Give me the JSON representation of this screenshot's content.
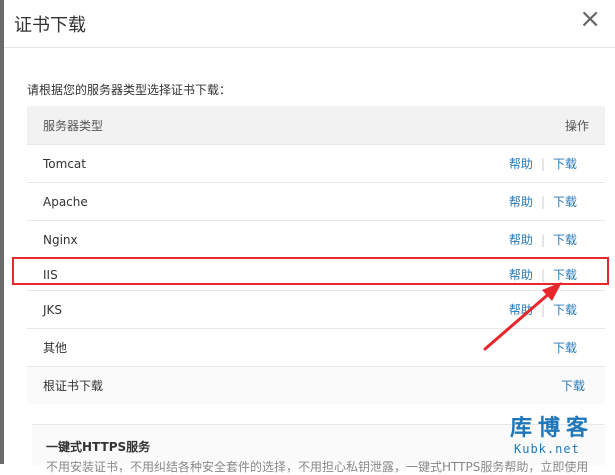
{
  "dialog": {
    "title": "证书下载",
    "close_icon": "×",
    "instruction": "请根据您的服务器类型选择证书下载："
  },
  "table": {
    "header_server": "服务器类型",
    "header_action": "操作",
    "rows": [
      {
        "name": "Tomcat",
        "help": "帮助",
        "download": "下载"
      },
      {
        "name": "Apache",
        "help": "帮助",
        "download": "下载"
      },
      {
        "name": "Nginx",
        "help": "帮助",
        "download": "下载"
      },
      {
        "name": "IIS",
        "help": "帮助",
        "download": "下载"
      },
      {
        "name": "JKS",
        "help": "帮助",
        "download": "下载"
      },
      {
        "name": "其他",
        "download": "下载"
      },
      {
        "name": "根证书下载",
        "download": "下载"
      }
    ]
  },
  "promo": {
    "title": "一键式HTTPS服务",
    "text": "不用安装证书，不用纠结各种安全套件的选择，不用担心私钥泄露，一键式HTTPS服务帮助，立即使用"
  },
  "watermark": {
    "top": "库博客",
    "bottom": "Kubk.net"
  },
  "colors": {
    "link": "#2a7ab7",
    "highlight": "#e8262c",
    "header_bg": "#f2f2f2"
  }
}
